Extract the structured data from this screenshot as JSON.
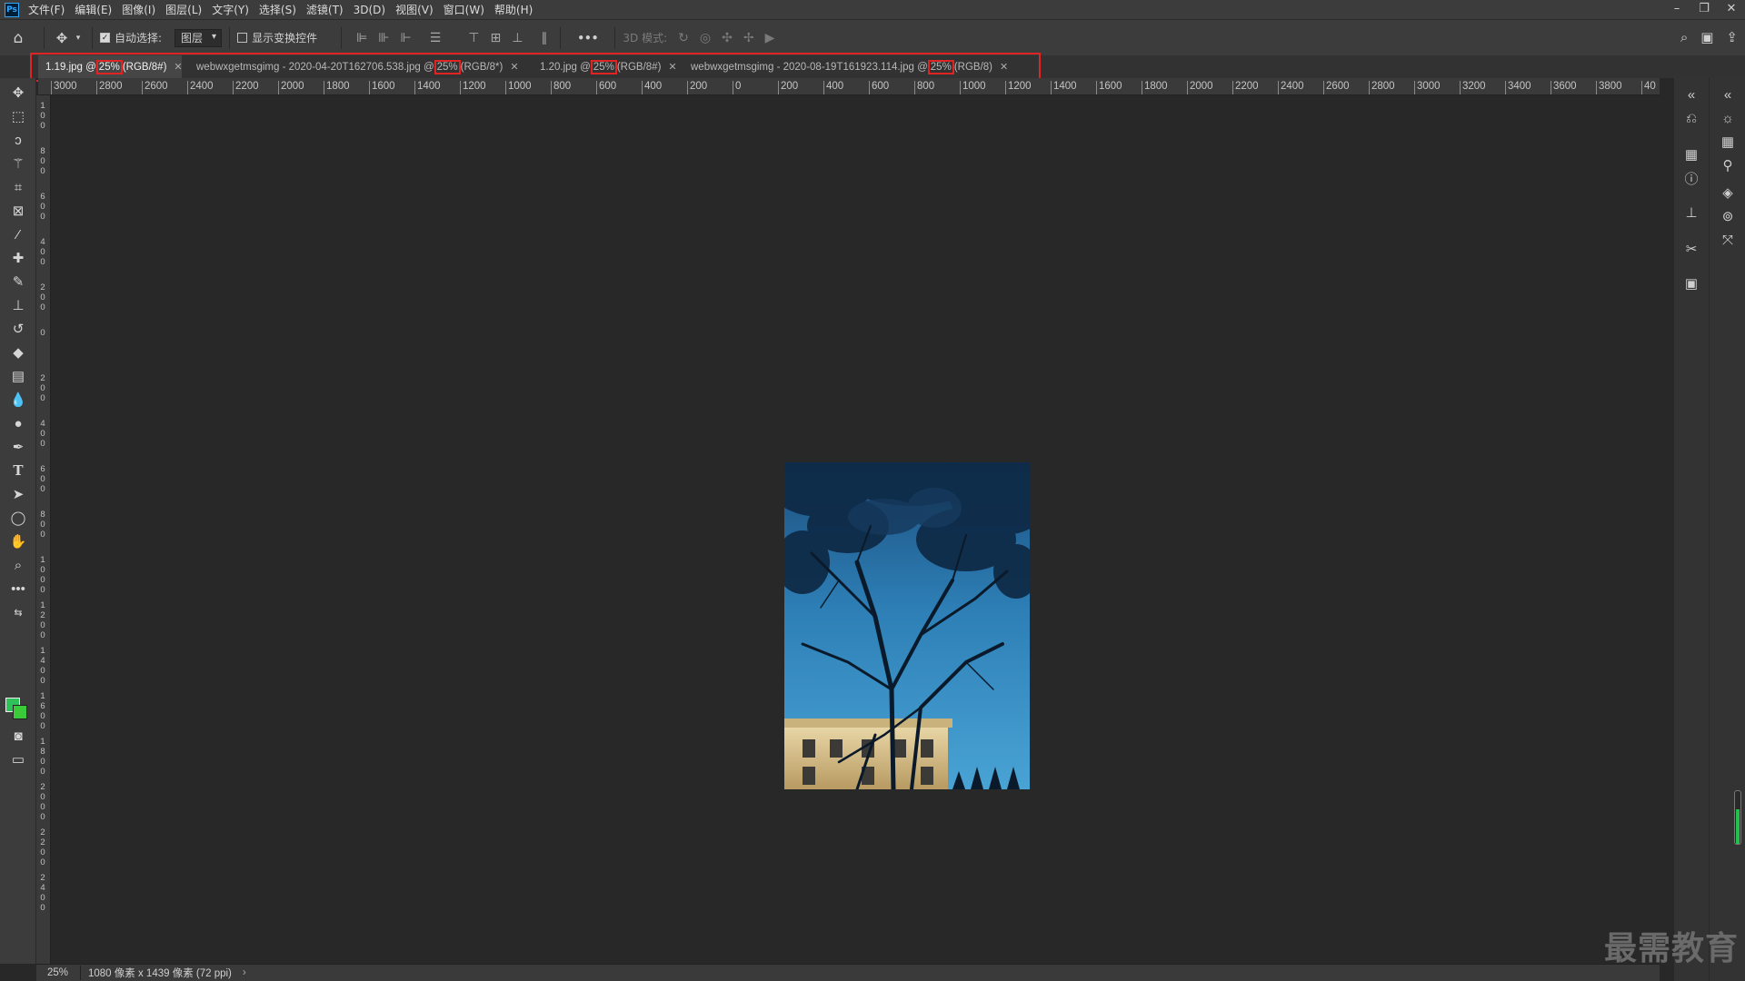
{
  "menubar": {
    "app_icon": "Ps",
    "items": [
      "文件(F)",
      "编辑(E)",
      "图像(I)",
      "图层(L)",
      "文字(Y)",
      "选择(S)",
      "滤镜(T)",
      "3D(D)",
      "视图(V)",
      "窗口(W)",
      "帮助(H)"
    ]
  },
  "options_bar": {
    "auto_select_label": "自动选择:",
    "auto_select_checked": true,
    "layer_select_value": "图层",
    "show_transform_label": "显示变换控件",
    "show_transform_checked": false,
    "more_label": "•••",
    "mode_3d_label": "3D 模式:"
  },
  "tabs": [
    {
      "pre": "1.19.jpg @ ",
      "zoom": "25%",
      "post": "(RGB/8#)",
      "active": true
    },
    {
      "pre": "webwxgetmsgimg - 2020-04-20T162706.538.jpg @ ",
      "zoom": "25%",
      "post": "(RGB/8*)",
      "active": false
    },
    {
      "pre": "1.20.jpg @ ",
      "zoom": "25%",
      "post": "(RGB/8#)",
      "active": false
    },
    {
      "pre": "webwxgetmsgimg - 2020-08-19T161923.114.jpg @ ",
      "zoom": "25%",
      "post": "(RGB/8)",
      "active": false
    }
  ],
  "ruler_h": [
    "3000",
    "2800",
    "2600",
    "2400",
    "2200",
    "2000",
    "1800",
    "1600",
    "1400",
    "1200",
    "1000",
    "800",
    "600",
    "400",
    "200",
    "0",
    "200",
    "400",
    "600",
    "800",
    "1000",
    "1200",
    "1400",
    "1600",
    "1800",
    "2000",
    "2200",
    "2400",
    "2600",
    "2800",
    "3000",
    "3200",
    "3400",
    "3600",
    "3800",
    "40"
  ],
  "ruler_v": [
    "100",
    "800",
    "600",
    "400",
    "200",
    "0",
    "200",
    "400",
    "600",
    "800",
    "1000",
    "1200",
    "1400",
    "1600",
    "1800",
    "2000",
    "2200",
    "2400"
  ],
  "status": {
    "zoom": "25%",
    "doc_info": "1080 像素 x 1439 像素 (72 ppi)",
    "arrow": "›"
  },
  "watermark": "最需教育",
  "colors": {
    "foreground": "#2fc25b",
    "background": "#3aca3a",
    "highlight": "#e02424"
  },
  "icons": {
    "tools": [
      "move-tool-icon",
      "marquee-tool-icon",
      "lasso-tool-icon",
      "magic-wand-icon",
      "crop-tool-icon",
      "frame-tool-icon",
      "eyedropper-icon",
      "healing-brush-icon",
      "brush-tool-icon",
      "clone-stamp-icon",
      "history-brush-icon",
      "eraser-icon",
      "gradient-tool-icon",
      "blur-tool-icon",
      "dodge-tool-icon",
      "pen-tool-icon",
      "type-tool-icon",
      "path-select-icon",
      "ellipse-tool-icon",
      "hand-tool-icon",
      "zoom-tool-icon",
      "more-tools-icon"
    ]
  }
}
